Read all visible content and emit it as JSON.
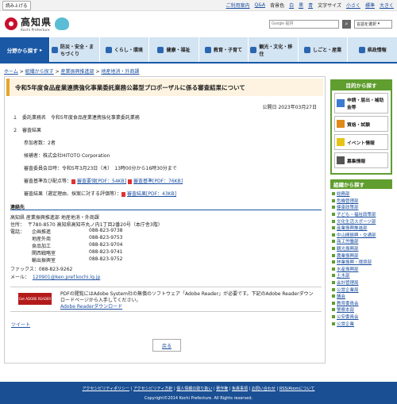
{
  "topbar": {
    "read_button": "読み上げる",
    "links": [
      "ご利用案内",
      "Q&A",
      "背景色",
      "白",
      "黒",
      "青",
      "文字サイズ",
      "小さく",
      "標準",
      "大きく"
    ]
  },
  "header": {
    "logo_jp": "高知県",
    "logo_en": "Kochi Prefecture",
    "search_placeholder": "Google 提供",
    "language_label": "言語を選択"
  },
  "nav": {
    "first": "分野から探す",
    "items": [
      "防災・安全・まちづくり",
      "くらし・環境",
      "健康・福祉",
      "教育・子育て",
      "観光・文化・移住",
      "しごと・産業",
      "県政情報"
    ]
  },
  "breadcrumb": [
    "ホーム",
    "組織から探す",
    "産業振興推進部",
    "地産地消・外商課"
  ],
  "article": {
    "title": "令和5年度食品産業連携強化事業委託業務公募型プロポーザルに係る審査結果について",
    "published": "公開日 2023年03月27日",
    "item1": "１　委託業務名　令和5年度食品産業連携強化事業委託業務",
    "item2": "２　審査結果",
    "participants": "参加者数：2者",
    "nominee": "候補者：株式会社HITOTO Corporation",
    "committee_date": "審査委員会日時：令和5年3月23日（木）　13時00分から16時30分まで",
    "criteria_label": "審査基準及び配点等：",
    "criteria_link1": "審査要領[PDF：54KB]",
    "criteria_link2": "審査基準[PDF：76KB]",
    "results_label": "審査結果（選定理由、採案に対する評価等）：",
    "results_link": "審査結果[PDF：43KB]"
  },
  "contact": {
    "heading": "連絡先",
    "dept": "高知県 産業振興推進部 地産地消・外商課",
    "address_label": "住所：",
    "address": "〒780-8570 高知県高知市丸ノ内1丁目2番20号（本庁舎3階）",
    "phone_label": "電話：",
    "phones": [
      {
        "name": "企画推進",
        "number": "088-823-9738"
      },
      {
        "name": "地産外商",
        "number": "088-823-9753"
      },
      {
        "name": "食品加工",
        "number": "088-823-9704"
      },
      {
        "name": "関西戦略室",
        "number": "088-823-9741"
      },
      {
        "name": "輸出振興室",
        "number": "088-823-9752"
      }
    ],
    "fax": "ファックス：088-823-9262",
    "mail_label": "メール：",
    "mail": "120901@ken.pref.kochi.lg.jp"
  },
  "adobe": {
    "logo_text": "Get ADOBE READER",
    "text": "PDFの閲覧にはAdobe System社の無償のソフトウェア「Adobe Reader」が必要です。下記のAdobe Readerダウンロードページから入手してください。",
    "link": "Adobe Readerダウンロード"
  },
  "tweet": "ツイート",
  "back": "戻る",
  "side": {
    "purpose_heading": "目的から探す",
    "purpose_items": [
      "申請・届出・補助金等",
      "資格・試験",
      "イベント情報",
      "募集情報"
    ],
    "org_heading": "組織から探す",
    "org_items": [
      "総務部",
      "危機管理部",
      "健康政策部",
      "子ども・福祉政策部",
      "文化生活スポーツ部",
      "産業振興推進部",
      "中山間振興・交通部",
      "商工労働部",
      "観光振興部",
      "農業振興部",
      "林業振興・環境部",
      "水産振興部",
      "土木部",
      "会計管理局",
      "公営企業局",
      "議会",
      "教育委員会",
      "警察本部",
      "公安委員会",
      "公営企業"
    ]
  },
  "footer": {
    "links": [
      "アクセシビリティポリシー",
      "アクセシビリティ方針",
      "個人情報の取り扱い",
      "著作権",
      "免責事項",
      "お問い合わせ",
      "RSS/Atomについて"
    ],
    "copyright": "Copyright©2014 Kochi Prefecture. All Rights reserved."
  },
  "colors": {
    "nav_blue": "#1a58a6",
    "side_green": "#5f9e2f",
    "title_orange": "#e4a42c",
    "footer_blue": "#1a4f94"
  }
}
